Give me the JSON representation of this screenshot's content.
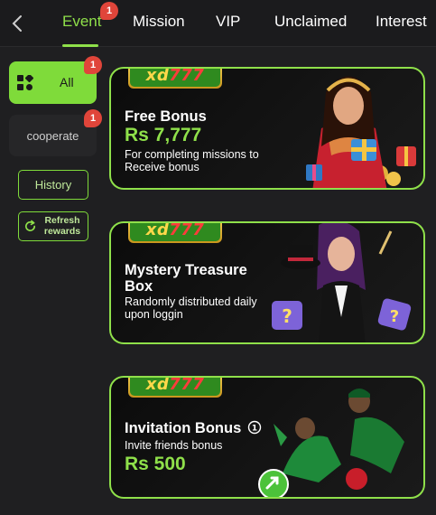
{
  "tabs": [
    {
      "label": "Event",
      "active": true,
      "badge": "1"
    },
    {
      "label": "Mission"
    },
    {
      "label": "VIP"
    },
    {
      "label": "Unclaimed"
    },
    {
      "label": "Interest"
    }
  ],
  "sidebar": {
    "all": {
      "label": "All",
      "badge": "1"
    },
    "cooperate": {
      "label": "cooperate",
      "badge": "1"
    },
    "history": {
      "label": "History"
    },
    "refresh": {
      "label": "Refresh rewards"
    }
  },
  "banners": [
    {
      "logo": {
        "xd": "xd",
        "num": "777"
      },
      "title": "Free Bonus",
      "amount": "Rs 7,777",
      "description": "For completing missions to Receive bonus"
    },
    {
      "logo": {
        "xd": "xd",
        "num": "777"
      },
      "title": "Mystery Treasure Box",
      "description": "Randomly distributed daily upon loggin"
    },
    {
      "logo": {
        "xd": "xd",
        "num": "777"
      },
      "title": "Invitation Bonus",
      "info_icon": "info-icon",
      "description": "Invite friends bonus",
      "amount": "Rs 500"
    }
  ],
  "colors": {
    "accent": "#8fe04a",
    "badge": "#e0453a",
    "background": "#1f1f21"
  }
}
